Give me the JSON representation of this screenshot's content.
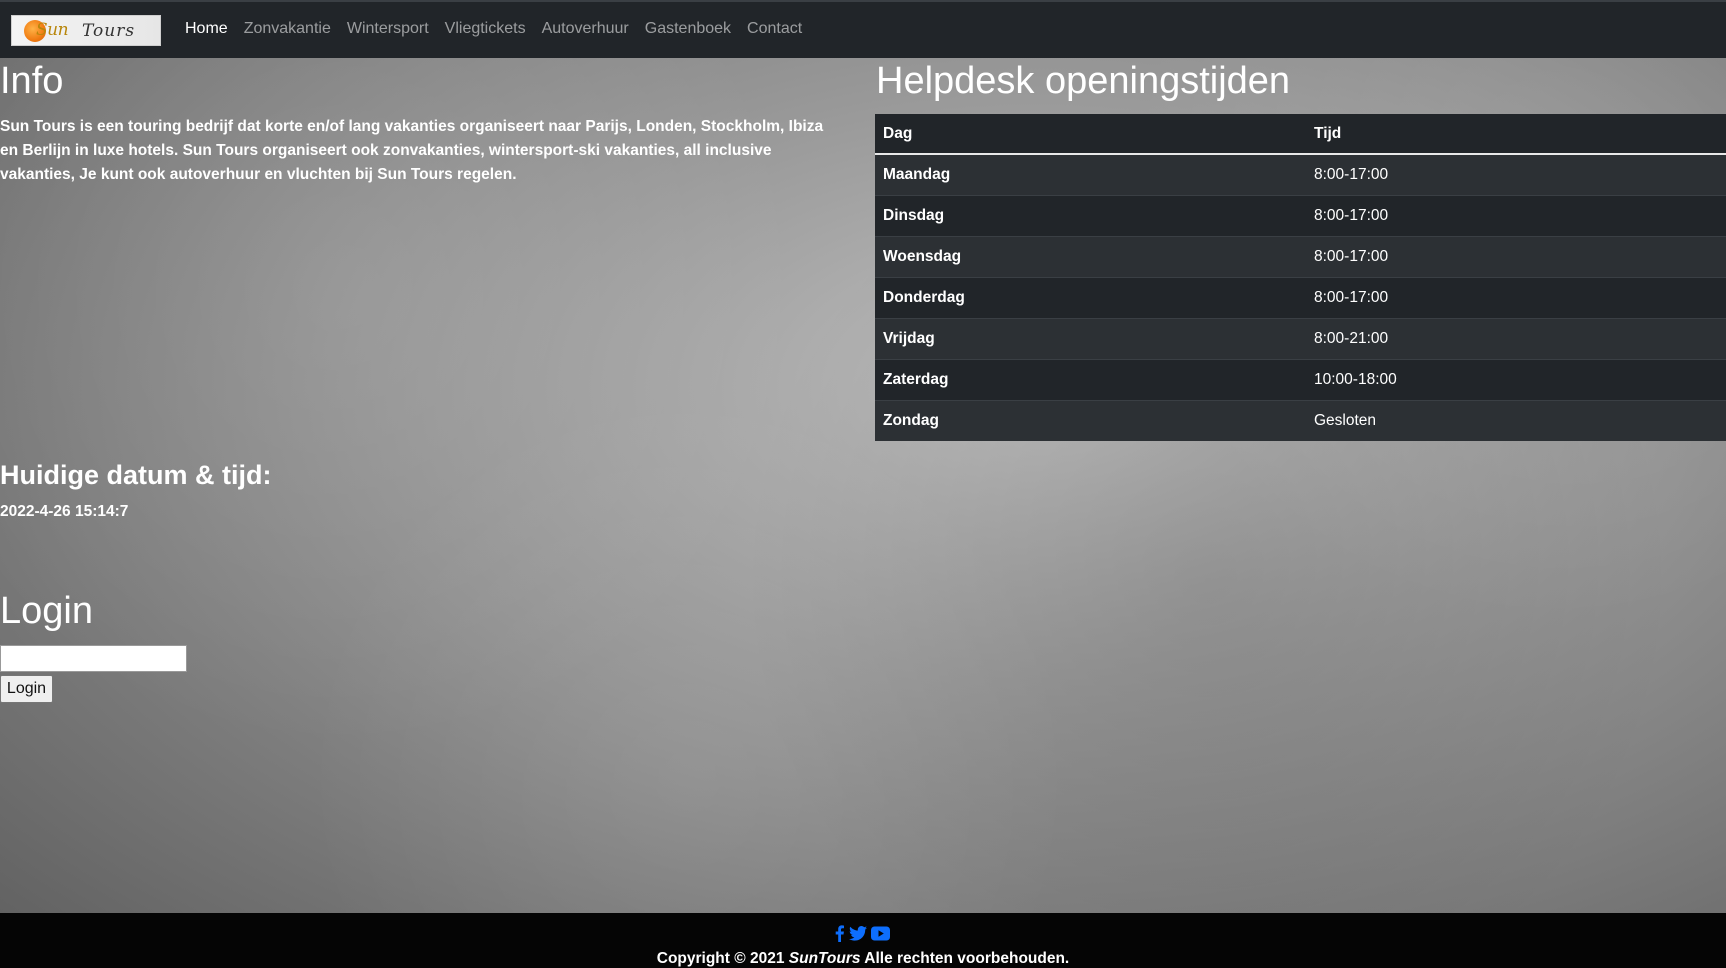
{
  "nav": {
    "brand": {
      "sun": "Sun",
      "tours": "Tours"
    },
    "links": [
      "Home",
      "Zonvakantie",
      "Wintersport",
      "Vliegtickets",
      "Autoverhuur",
      "Gastenboek",
      "Contact"
    ]
  },
  "info": {
    "heading": "Info",
    "text": "Sun Tours is een touring bedrijf dat korte en/of lang vakanties organiseert naar Parijs, Londen, Stockholm, Ibiza en Berlijn in luxe hotels. Sun Tours organiseert ook zonvakanties, wintersport-ski vakanties, all inclusive vakanties, Je kunt ook autoverhuur en vluchten bij Sun Tours regelen."
  },
  "datetime": {
    "heading": "Huidige datum & tijd:",
    "value": "2022-4-26 15:14:7"
  },
  "login": {
    "heading": "Login",
    "input_value": "",
    "button_label": "Login"
  },
  "helpdesk": {
    "heading": "Helpdesk openingstijden",
    "columns": [
      "Dag",
      "Tijd"
    ],
    "rows": [
      {
        "day": "Maandag",
        "time": "8:00-17:00"
      },
      {
        "day": "Dinsdag",
        "time": "8:00-17:00"
      },
      {
        "day": "Woensdag",
        "time": "8:00-17:00"
      },
      {
        "day": "Donderdag",
        "time": "8:00-17:00"
      },
      {
        "day": "Vrijdag",
        "time": "8:00-21:00"
      },
      {
        "day": "Zaterdag",
        "time": "10:00-18:00"
      },
      {
        "day": "Zondag",
        "time": "Gesloten"
      }
    ]
  },
  "footer": {
    "social_icons": [
      "facebook-icon",
      "twitter-icon",
      "youtube-icon"
    ],
    "copyright_prefix": "Copyright © 2021 ",
    "copyright_brand": "SunTours",
    "copyright_suffix": " Alle rechten voorbehouden."
  },
  "colors": {
    "navbar": "#212529",
    "social": "#0d6efd",
    "footer": "#050505"
  }
}
